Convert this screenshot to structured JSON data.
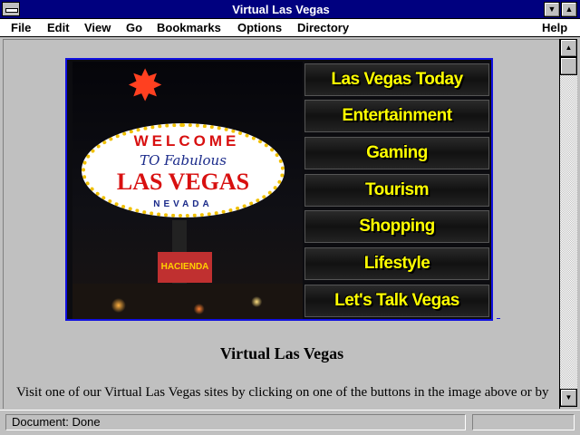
{
  "window": {
    "title": "Virtual Las Vegas"
  },
  "menu": {
    "file": "File",
    "edit": "Edit",
    "view": "View",
    "go": "Go",
    "bookmarks": "Bookmarks",
    "options": "Options",
    "directory": "Directory",
    "help": "Help"
  },
  "sign": {
    "welcome": "WELCOME",
    "to_fabulous": "TO Fabulous",
    "las_vegas": "LAS VEGAS",
    "nevada": "NEVADA",
    "hacienda": "HACIENDA"
  },
  "nav_buttons": [
    {
      "label": "Las Vegas Today"
    },
    {
      "label": "Entertainment"
    },
    {
      "label": "Gaming"
    },
    {
      "label": "Tourism"
    },
    {
      "label": "Shopping"
    },
    {
      "label": "Lifestyle"
    },
    {
      "label": "Let's Talk Vegas"
    }
  ],
  "page": {
    "heading": "Virtual Las Vegas",
    "paragraph": "Visit one of our Virtual Las Vegas sites by clicking on one of the buttons in the image above or by"
  },
  "status": {
    "text": "Document: Done"
  },
  "colors": {
    "titlebar": "#00007f",
    "button_text": "#ffff00",
    "link_border": "#1010e0"
  },
  "icons": {
    "minimize": "down-triangle",
    "maximize": "up-triangle",
    "system_menu": "dash"
  }
}
